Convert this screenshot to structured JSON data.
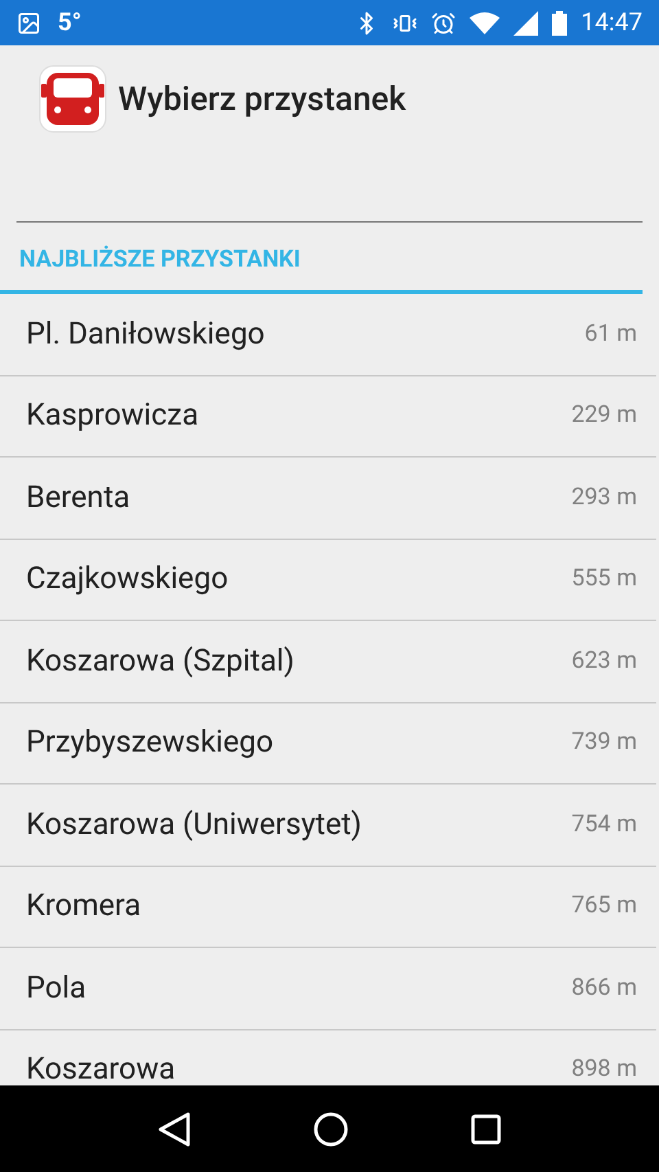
{
  "status_bar": {
    "temperature": "5°",
    "time": "14:47"
  },
  "header": {
    "title": "Wybierz przystanek"
  },
  "section": {
    "title": "NAJBLIŻSZE PRZYSTANKI"
  },
  "stops": [
    {
      "name": "Pl. Daniłowskiego",
      "distance": "61 m"
    },
    {
      "name": "Kasprowicza",
      "distance": "229 m"
    },
    {
      "name": "Berenta",
      "distance": "293 m"
    },
    {
      "name": "Czajkowskiego",
      "distance": "555 m"
    },
    {
      "name": "Koszarowa (Szpital)",
      "distance": "623 m"
    },
    {
      "name": "Przybyszewskiego",
      "distance": "739 m"
    },
    {
      "name": "Koszarowa (Uniwersytet)",
      "distance": "754 m"
    },
    {
      "name": "Kromera",
      "distance": "765 m"
    },
    {
      "name": "Pola",
      "distance": "866 m"
    },
    {
      "name": "Koszarowa",
      "distance": "898 m"
    }
  ]
}
